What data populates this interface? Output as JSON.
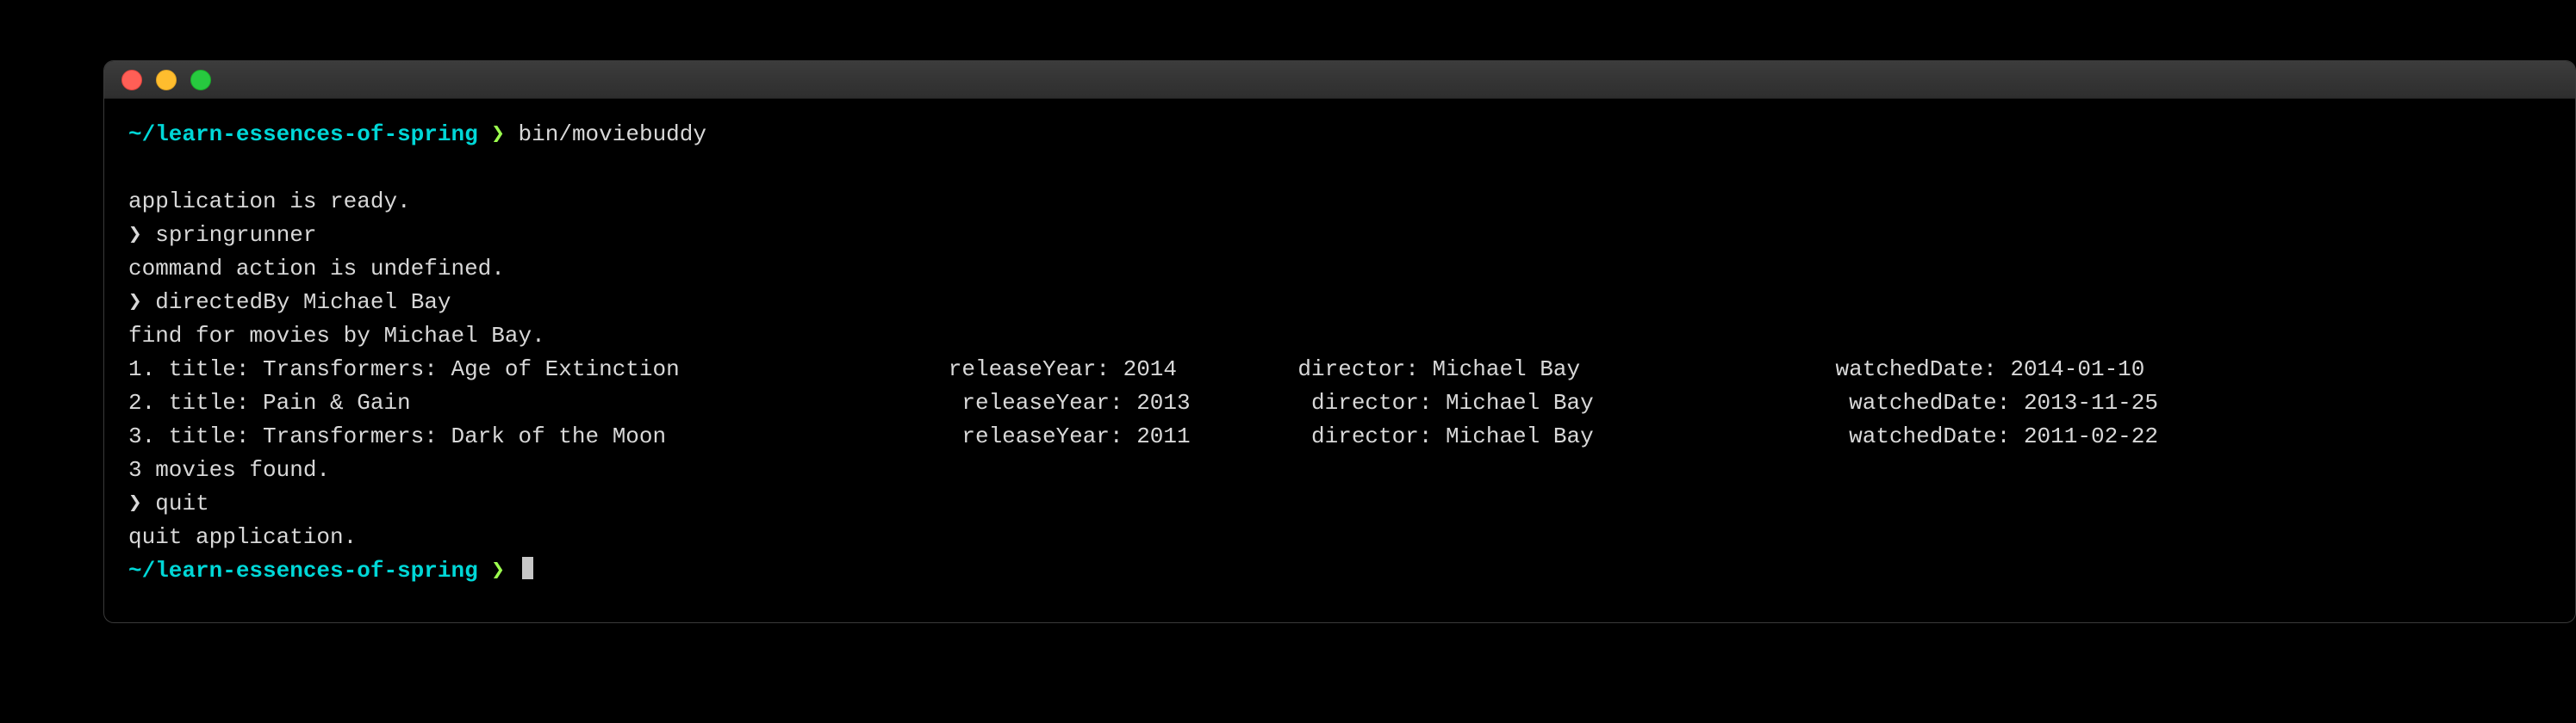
{
  "prompt": {
    "path": "~/learn-essences-of-spring",
    "arrow": "❯"
  },
  "session": {
    "first_command": "bin/moviebuddy",
    "lines": {
      "ready": "application is ready.",
      "sub_prompt": "❯",
      "sub_cmd1": "springrunner",
      "undefined": "command action is undefined.",
      "sub_cmd2": "directedBy Michael Bay",
      "find_msg": "find for movies by Michael Bay.",
      "result1": "1. title: Transformers: Age of Extinction                    releaseYear: 2014         director: Michael Bay                   watchedDate: 2014-01-10",
      "result2": "2. title: Pain & Gain                                         releaseYear: 2013         director: Michael Bay                   watchedDate: 2013-11-25",
      "result3": "3. title: Transformers: Dark of the Moon                      releaseYear: 2011         director: Michael Bay                   watchedDate: 2011-02-22",
      "found_msg": "3 movies found.",
      "sub_cmd3": "quit",
      "quit_msg": "quit application."
    }
  }
}
